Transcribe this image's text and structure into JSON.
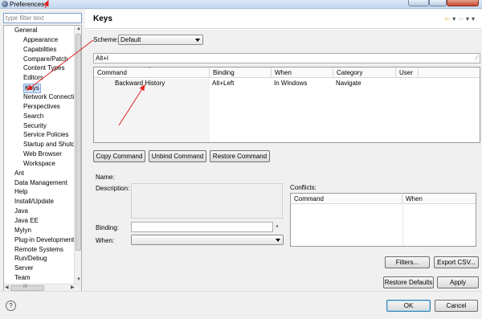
{
  "window": {
    "title": "Preferences"
  },
  "filter": {
    "placeholder": "type filter text"
  },
  "tree": {
    "items": [
      {
        "label": "General",
        "level": 1
      },
      {
        "label": "Appearance",
        "level": 2
      },
      {
        "label": "Capabilities",
        "level": 2
      },
      {
        "label": "Compare/Patch",
        "level": 2
      },
      {
        "label": "Content Types",
        "level": 2
      },
      {
        "label": "Editors",
        "level": 2
      },
      {
        "label": "Keys",
        "level": 2,
        "selected": true
      },
      {
        "label": "Network Connecti",
        "level": 2
      },
      {
        "label": "Perspectives",
        "level": 2
      },
      {
        "label": "Search",
        "level": 2
      },
      {
        "label": "Security",
        "level": 2
      },
      {
        "label": "Service Policies",
        "level": 2
      },
      {
        "label": "Startup and Shutd",
        "level": 2
      },
      {
        "label": "Web Browser",
        "level": 2
      },
      {
        "label": "Workspace",
        "level": 2
      },
      {
        "label": "Ant",
        "level": 1
      },
      {
        "label": "Data Management",
        "level": 1
      },
      {
        "label": "Help",
        "level": 1
      },
      {
        "label": "Install/Update",
        "level": 1
      },
      {
        "label": "Java",
        "level": 1
      },
      {
        "label": "Java EE",
        "level": 1
      },
      {
        "label": "Mylyn",
        "level": 1
      },
      {
        "label": "Plug-in Development",
        "level": 1
      },
      {
        "label": "Remote Systems",
        "level": 1
      },
      {
        "label": "Run/Debug",
        "level": 1
      },
      {
        "label": "Server",
        "level": 1
      },
      {
        "label": "Team",
        "level": 1
      }
    ],
    "hscroll_glyph": "III"
  },
  "page": {
    "title": "Keys"
  },
  "scheme": {
    "label": "Scheme:",
    "value": "Default"
  },
  "keyfilter": {
    "value": "Alt+l"
  },
  "bindings_table": {
    "columns": [
      "Command",
      "Binding",
      "When",
      "Category",
      "User"
    ],
    "rows": [
      {
        "command": "Backward History",
        "binding": "Alt+Left",
        "when": "In Windows",
        "category": "Navigate",
        "user": ""
      }
    ]
  },
  "buttons": {
    "copy": "Copy Command",
    "unbind": "Unbind Command",
    "restore": "Restore Command",
    "filters": "Filters...",
    "export": "Export CSV...",
    "restore_defaults": "Restore Defaults",
    "apply": "Apply",
    "ok": "OK",
    "cancel": "Cancel"
  },
  "details": {
    "name_label": "Name:",
    "description_label": "Description:",
    "binding_label": "Binding:",
    "when_label": "When:",
    "conflicts_label": "Conflicts:"
  },
  "conflicts_table": {
    "columns": [
      "Command",
      "When"
    ]
  },
  "help": {
    "glyph": "?"
  },
  "colors": {
    "accent_arrow": "#e02020",
    "selection": "#cfe3fb"
  }
}
